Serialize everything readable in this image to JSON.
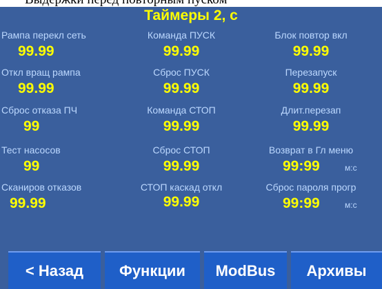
{
  "header": {
    "cut_text": "Выдержки перед повторным пуском",
    "title": "Таймеры 2,  с"
  },
  "timers": [
    {
      "label": "Рампа перекл сеть",
      "value": "99.99"
    },
    {
      "label": "Команда ПУСК",
      "value": "99.99"
    },
    {
      "label": "Блок повтор вкл",
      "value": "99.99"
    },
    {
      "label": "Откл вращ рампа",
      "value": "99.99"
    },
    {
      "label": "Сброс ПУСК",
      "value": "99.99"
    },
    {
      "label": "Перезапуск",
      "value": "99.99"
    },
    {
      "label": "Сброс отказа ПЧ",
      "value": "99"
    },
    {
      "label": "Команда СТОП",
      "value": "99.99"
    },
    {
      "label": "Длит.перезап",
      "value": "99.99"
    },
    {
      "label": "Тест насосов",
      "value": "99"
    },
    {
      "label": "Сброс СТОП",
      "value": "99.99"
    },
    {
      "label": "Возврат в Гл меню",
      "value": "99:99",
      "unit": "м:с"
    },
    {
      "label": "Сканиров отказов",
      "value": "99.99"
    },
    {
      "label": "СТОП каскад откл",
      "value": "99.99"
    },
    {
      "label": "Сброс пароля прогр",
      "value": "99:99",
      "unit": "м:с"
    }
  ],
  "nav": {
    "back": "< Назад",
    "functions": "Функции",
    "modbus": "ModBus",
    "archives": "Архивы"
  },
  "colors": {
    "panel": "#3a5f9d",
    "value": "#ffff00",
    "label": "#bcd8ff",
    "button": "#1f5fc8"
  }
}
